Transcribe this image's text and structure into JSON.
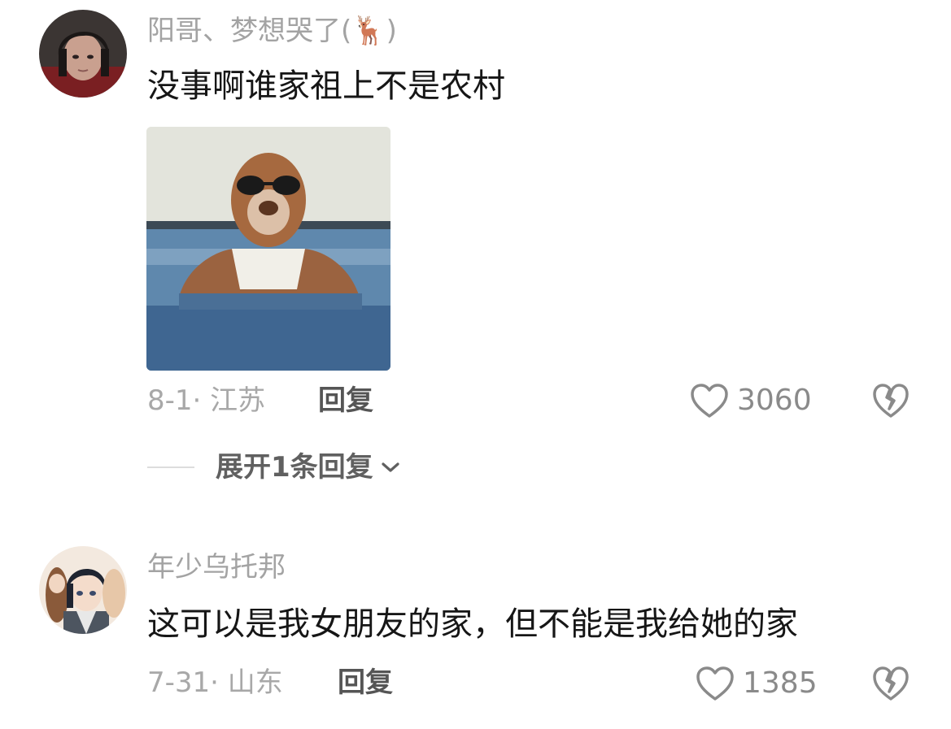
{
  "comments": [
    {
      "username": "阳哥、梦想哭了(🦌)",
      "text": "没事啊谁家祖上不是农村",
      "date_location": "8-1· 江苏",
      "reply_label": "回复",
      "like_count": "3060",
      "expand_label": "展开1条回复",
      "avatar_icon": "avatar-dark-hair-boy",
      "image_icon": "bear-in-water-sunglasses-meme"
    },
    {
      "username": "年少乌托邦",
      "text": "这可以是我女朋友的家，但不能是我给她的家",
      "date_location": "7-31· 山东",
      "reply_label": "回复",
      "like_count": "1385",
      "avatar_icon": "avatar-anime-characters"
    }
  ],
  "icons": {
    "like": "heart-outline-icon",
    "dislike": "broken-heart-icon",
    "expand": "chevron-down-icon"
  },
  "colors": {
    "username": "#a3a3a3",
    "text": "#161616",
    "meta": "#a8a8a8",
    "icon": "#8a8a8a"
  }
}
